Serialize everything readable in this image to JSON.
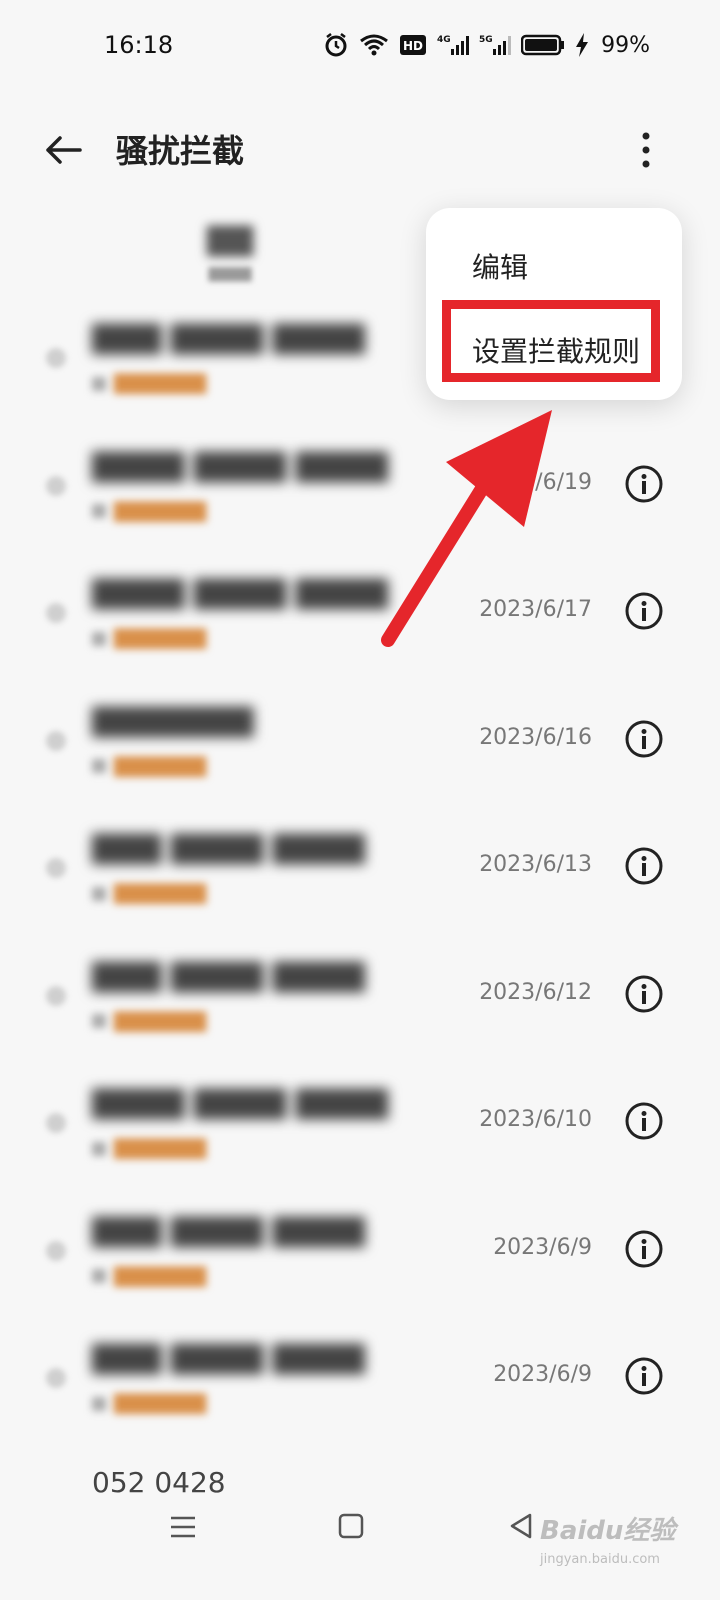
{
  "status_bar": {
    "time": "16:18",
    "battery_percent": "99%",
    "icons": [
      "alarm-icon",
      "wifi-icon",
      "hd-icon",
      "4g-signal-icon",
      "5g-signal-icon",
      "battery-icon",
      "charging-icon"
    ]
  },
  "header": {
    "title": "骚扰拦截"
  },
  "menu": {
    "edit_label": "编辑",
    "rule_label": "设置拦截规则"
  },
  "call_list": [
    {
      "date": ""
    },
    {
      "date": "2023/6/19"
    },
    {
      "date": "2023/6/17"
    },
    {
      "date": "2023/6/16"
    },
    {
      "date": "2023/6/13"
    },
    {
      "date": "2023/6/12"
    },
    {
      "date": "2023/6/10"
    },
    {
      "date": "2023/6/9"
    },
    {
      "date": "2023/6/9"
    }
  ],
  "partial_row_text": "052 0428",
  "colors": {
    "highlight": "#e5262b",
    "tag": "#d9904a",
    "background": "#f7f7f7"
  },
  "watermark": {
    "main": "Baidu经验",
    "sub": "jingyan.baidu.com"
  }
}
